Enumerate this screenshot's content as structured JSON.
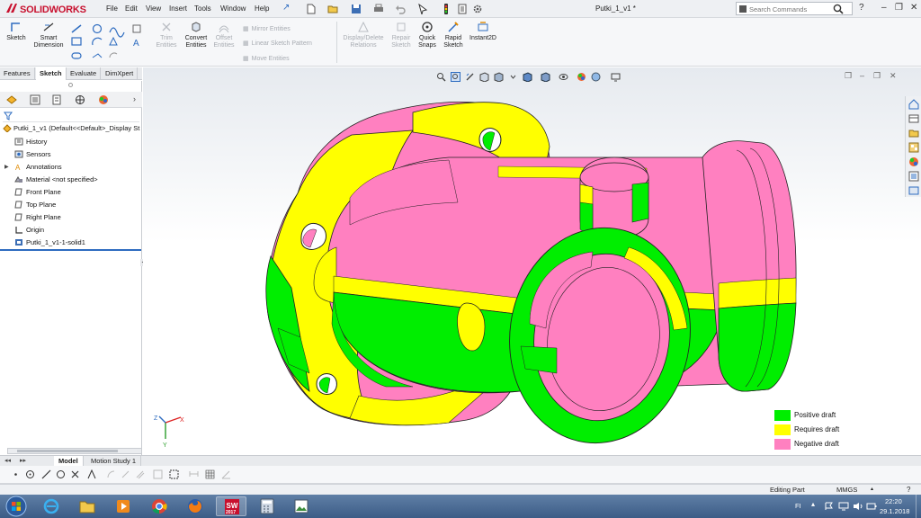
{
  "app": {
    "brand": "SOLIDWORKS",
    "document_title": "Putki_1_v1 *",
    "menu": [
      "File",
      "Edit",
      "View",
      "Insert",
      "Tools",
      "Window",
      "Help"
    ],
    "search_placeholder": "Search Commands"
  },
  "command_manager": {
    "tools": [
      {
        "label": "Sketch",
        "enabled": true
      },
      {
        "label": "Smart Dimension",
        "enabled": true
      },
      {
        "label": "Trim Entities",
        "enabled": false
      },
      {
        "label": "Convert Entities",
        "enabled": true
      },
      {
        "label": "Offset Entities",
        "enabled": false
      },
      {
        "label": "Mirror Entities",
        "enabled": false
      },
      {
        "label": "Linear Sketch Pattern",
        "enabled": false
      },
      {
        "label": "Move Entities",
        "enabled": false
      },
      {
        "label": "Display/Delete Relations",
        "enabled": false
      },
      {
        "label": "Repair Sketch",
        "enabled": false
      },
      {
        "label": "Quick Snaps",
        "enabled": true
      },
      {
        "label": "Rapid Sketch",
        "enabled": true
      },
      {
        "label": "Instant2D",
        "enabled": true
      }
    ]
  },
  "tabs": [
    "Features",
    "Sketch",
    "Evaluate",
    "DimXpert"
  ],
  "active_tab": "Sketch",
  "feature_tree": {
    "root": "Putki_1_v1  (Default<<Default>_Display St",
    "items": [
      {
        "label": "History",
        "icon": "history-icon"
      },
      {
        "label": "Sensors",
        "icon": "sensor-icon"
      },
      {
        "label": "Annotations",
        "icon": "annotation-icon",
        "expandable": true
      },
      {
        "label": "Material <not specified>",
        "icon": "material-icon"
      },
      {
        "label": "Front Plane",
        "icon": "plane-icon"
      },
      {
        "label": "Top Plane",
        "icon": "plane-icon"
      },
      {
        "label": "Right Plane",
        "icon": "plane-icon"
      },
      {
        "label": "Origin",
        "icon": "origin-icon"
      },
      {
        "label": "Putki_1_v1-1-solid1",
        "icon": "solid-body-icon"
      }
    ]
  },
  "legend": [
    {
      "label": "Positive draft",
      "color": "#00ee00"
    },
    {
      "label": "Requires draft",
      "color": "#ffff00"
    },
    {
      "label": "Negative draft",
      "color": "#ff80c0"
    }
  ],
  "bottom_tabs": [
    "Model",
    "Motion Study 1"
  ],
  "active_bottom_tab": "Model",
  "status": {
    "mode": "Editing Part",
    "units": "MMGS"
  },
  "taskbar": {
    "language": "FI",
    "time": "22:20",
    "date": "29.1.2018",
    "solidworks_badge": "2017"
  }
}
